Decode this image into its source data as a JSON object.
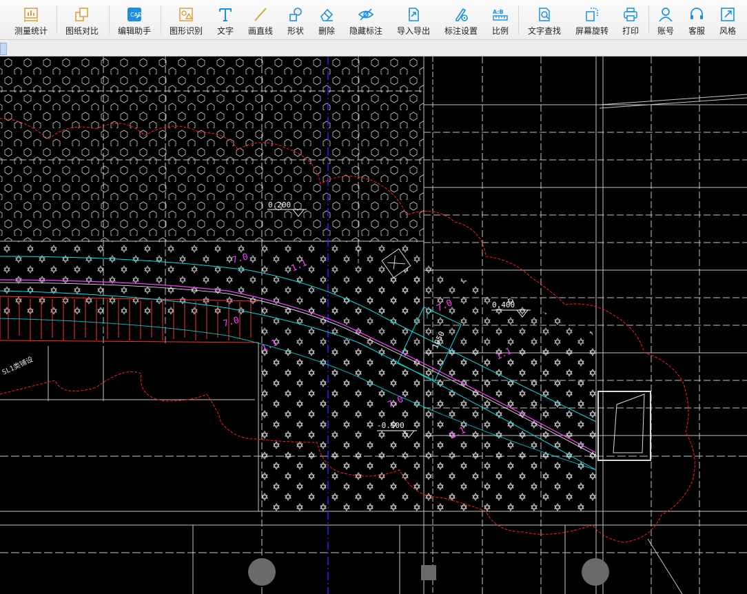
{
  "toolbar": {
    "items": [
      {
        "label": "测量统计",
        "icon": "measure-stats-icon"
      },
      {
        "label": "图纸对比",
        "icon": "compare-drawings-icon"
      },
      {
        "label": "编辑助手",
        "icon": "edit-assistant-icon"
      },
      {
        "label": "图形识别",
        "icon": "shape-recognition-icon"
      },
      {
        "label": "文字",
        "icon": "text-icon"
      },
      {
        "label": "画直线",
        "icon": "draw-line-icon"
      },
      {
        "label": "形状",
        "icon": "shape-icon"
      },
      {
        "label": "删除",
        "icon": "eraser-icon"
      },
      {
        "label": "隐藏标注",
        "icon": "hide-annotation-icon"
      },
      {
        "label": "导入导出",
        "icon": "import-export-icon"
      },
      {
        "label": "标注设置",
        "icon": "annotation-settings-icon"
      },
      {
        "label": "比例",
        "icon": "scale-icon"
      },
      {
        "label": "文字查找",
        "icon": "text-search-icon"
      },
      {
        "label": "屏幕旋转",
        "icon": "screen-rotate-icon"
      },
      {
        "label": "打印",
        "icon": "print-icon"
      },
      {
        "label": "账号",
        "icon": "account-icon"
      },
      {
        "label": "客服",
        "icon": "customer-service-icon"
      },
      {
        "label": "风格",
        "icon": "style-icon"
      }
    ]
  },
  "drawing": {
    "elevation_1": "0.200",
    "elevation_2": "0.400",
    "elevation_3": "-0.500",
    "ramp_width": "1050",
    "slope_label_1": "7.0",
    "slope_label_2": "1.1",
    "note_left": "SL1类铺设",
    "colors": {
      "background": "#000000",
      "grid": "#ffffff",
      "revision_cloud": "#ff2020",
      "cyan_lines": "#00e5e5",
      "magenta_text": "#ff40ff",
      "axis_blue": "#2a2aff",
      "red_hatch": "#ff3030"
    }
  }
}
